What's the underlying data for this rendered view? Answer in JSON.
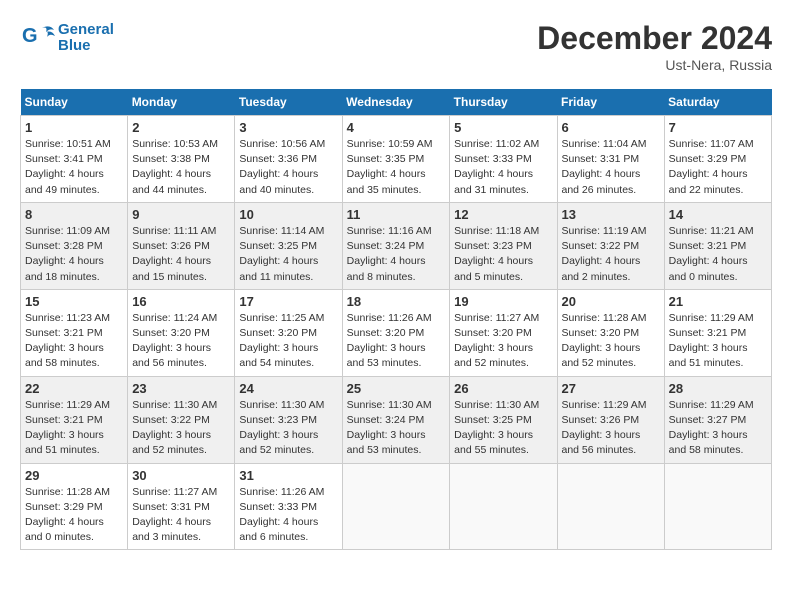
{
  "header": {
    "logo_line1": "General",
    "logo_line2": "Blue",
    "month": "December 2024",
    "location": "Ust-Nera, Russia"
  },
  "weekdays": [
    "Sunday",
    "Monday",
    "Tuesday",
    "Wednesday",
    "Thursday",
    "Friday",
    "Saturday"
  ],
  "weeks": [
    [
      {
        "day": "1",
        "sunrise": "10:51 AM",
        "sunset": "3:41 PM",
        "daylight": "4 hours and 49 minutes."
      },
      {
        "day": "2",
        "sunrise": "10:53 AM",
        "sunset": "3:38 PM",
        "daylight": "4 hours and 44 minutes."
      },
      {
        "day": "3",
        "sunrise": "10:56 AM",
        "sunset": "3:36 PM",
        "daylight": "4 hours and 40 minutes."
      },
      {
        "day": "4",
        "sunrise": "10:59 AM",
        "sunset": "3:35 PM",
        "daylight": "4 hours and 35 minutes."
      },
      {
        "day": "5",
        "sunrise": "11:02 AM",
        "sunset": "3:33 PM",
        "daylight": "4 hours and 31 minutes."
      },
      {
        "day": "6",
        "sunrise": "11:04 AM",
        "sunset": "3:31 PM",
        "daylight": "4 hours and 26 minutes."
      },
      {
        "day": "7",
        "sunrise": "11:07 AM",
        "sunset": "3:29 PM",
        "daylight": "4 hours and 22 minutes."
      }
    ],
    [
      {
        "day": "8",
        "sunrise": "11:09 AM",
        "sunset": "3:28 PM",
        "daylight": "4 hours and 18 minutes."
      },
      {
        "day": "9",
        "sunrise": "11:11 AM",
        "sunset": "3:26 PM",
        "daylight": "4 hours and 15 minutes."
      },
      {
        "day": "10",
        "sunrise": "11:14 AM",
        "sunset": "3:25 PM",
        "daylight": "4 hours and 11 minutes."
      },
      {
        "day": "11",
        "sunrise": "11:16 AM",
        "sunset": "3:24 PM",
        "daylight": "4 hours and 8 minutes."
      },
      {
        "day": "12",
        "sunrise": "11:18 AM",
        "sunset": "3:23 PM",
        "daylight": "4 hours and 5 minutes."
      },
      {
        "day": "13",
        "sunrise": "11:19 AM",
        "sunset": "3:22 PM",
        "daylight": "4 hours and 2 minutes."
      },
      {
        "day": "14",
        "sunrise": "11:21 AM",
        "sunset": "3:21 PM",
        "daylight": "4 hours and 0 minutes."
      }
    ],
    [
      {
        "day": "15",
        "sunrise": "11:23 AM",
        "sunset": "3:21 PM",
        "daylight": "3 hours and 58 minutes."
      },
      {
        "day": "16",
        "sunrise": "11:24 AM",
        "sunset": "3:20 PM",
        "daylight": "3 hours and 56 minutes."
      },
      {
        "day": "17",
        "sunrise": "11:25 AM",
        "sunset": "3:20 PM",
        "daylight": "3 hours and 54 minutes."
      },
      {
        "day": "18",
        "sunrise": "11:26 AM",
        "sunset": "3:20 PM",
        "daylight": "3 hours and 53 minutes."
      },
      {
        "day": "19",
        "sunrise": "11:27 AM",
        "sunset": "3:20 PM",
        "daylight": "3 hours and 52 minutes."
      },
      {
        "day": "20",
        "sunrise": "11:28 AM",
        "sunset": "3:20 PM",
        "daylight": "3 hours and 52 minutes."
      },
      {
        "day": "21",
        "sunrise": "11:29 AM",
        "sunset": "3:21 PM",
        "daylight": "3 hours and 51 minutes."
      }
    ],
    [
      {
        "day": "22",
        "sunrise": "11:29 AM",
        "sunset": "3:21 PM",
        "daylight": "3 hours and 51 minutes."
      },
      {
        "day": "23",
        "sunrise": "11:30 AM",
        "sunset": "3:22 PM",
        "daylight": "3 hours and 52 minutes."
      },
      {
        "day": "24",
        "sunrise": "11:30 AM",
        "sunset": "3:23 PM",
        "daylight": "3 hours and 52 minutes."
      },
      {
        "day": "25",
        "sunrise": "11:30 AM",
        "sunset": "3:24 PM",
        "daylight": "3 hours and 53 minutes."
      },
      {
        "day": "26",
        "sunrise": "11:30 AM",
        "sunset": "3:25 PM",
        "daylight": "3 hours and 55 minutes."
      },
      {
        "day": "27",
        "sunrise": "11:29 AM",
        "sunset": "3:26 PM",
        "daylight": "3 hours and 56 minutes."
      },
      {
        "day": "28",
        "sunrise": "11:29 AM",
        "sunset": "3:27 PM",
        "daylight": "3 hours and 58 minutes."
      }
    ],
    [
      {
        "day": "29",
        "sunrise": "11:28 AM",
        "sunset": "3:29 PM",
        "daylight": "4 hours and 0 minutes."
      },
      {
        "day": "30",
        "sunrise": "11:27 AM",
        "sunset": "3:31 PM",
        "daylight": "4 hours and 3 minutes."
      },
      {
        "day": "31",
        "sunrise": "11:26 AM",
        "sunset": "3:33 PM",
        "daylight": "4 hours and 6 minutes."
      },
      null,
      null,
      null,
      null
    ]
  ]
}
